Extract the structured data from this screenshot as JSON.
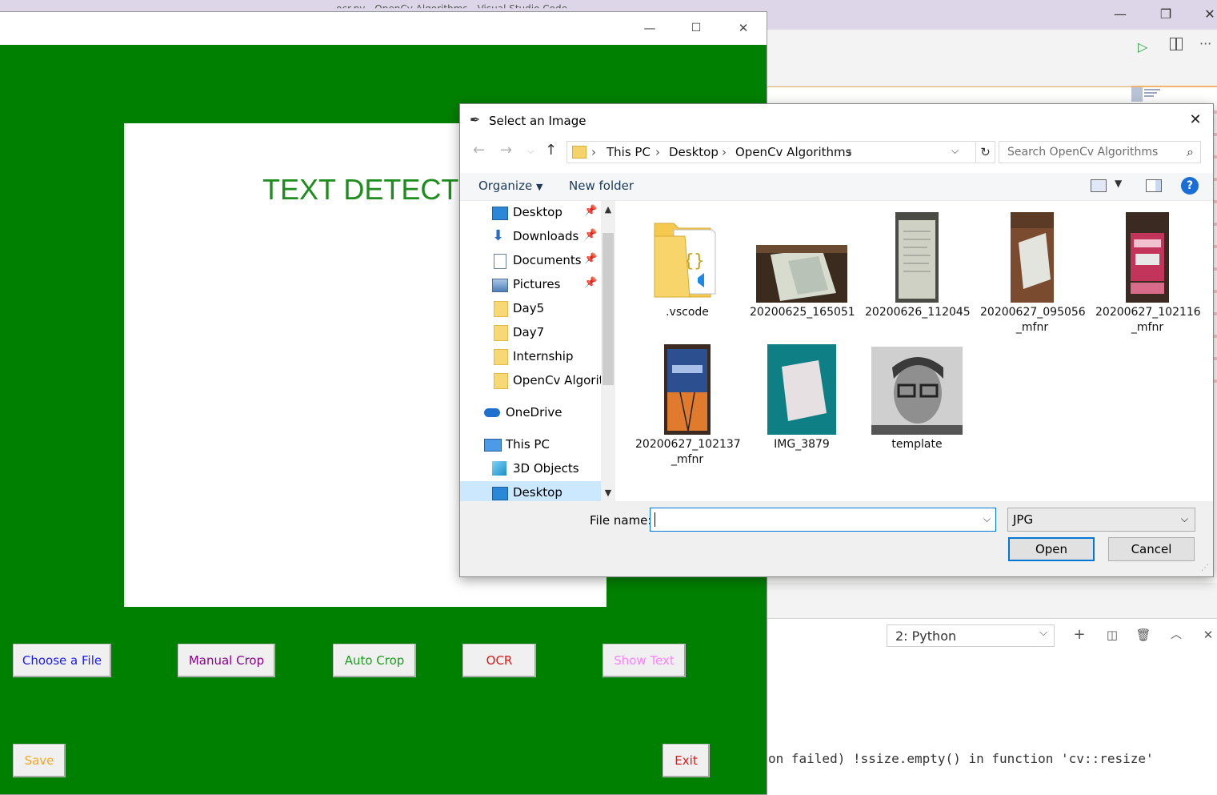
{
  "vscode": {
    "title": "ocr.py - OpenCv Algorithms - Visual Studio Code",
    "terminal_select": "2: Python",
    "terminal_output": "on failed) !ssize.empty() in function 'cv::resize'"
  },
  "app": {
    "heading": "TEXT DETECTOR",
    "buttons": {
      "choose": "Choose a File",
      "manual_crop": "Manual Crop",
      "auto_crop": "Auto Crop",
      "ocr": "OCR",
      "show_text": "Show Text",
      "save": "Save",
      "exit": "Exit"
    },
    "colors": {
      "background": "#008000",
      "choose": "#1a1aff",
      "manual_crop": "#8b008b",
      "auto_crop": "#1e9b1e",
      "ocr": "#e01818",
      "show_text": "#ff80ff",
      "save": "#f5a623",
      "exit": "#e01818"
    }
  },
  "dialog": {
    "title": "Select an Image",
    "breadcrumb": [
      "This PC",
      "Desktop",
      "OpenCv Algorithms"
    ],
    "search_placeholder": "Search OpenCv Algorithms",
    "organize": "Organize",
    "new_folder": "New folder",
    "nav_items": [
      {
        "label": "Desktop",
        "icon": "desktop-icon",
        "pinned": true
      },
      {
        "label": "Downloads",
        "icon": "download-icon",
        "pinned": true
      },
      {
        "label": "Documents",
        "icon": "documents-icon",
        "pinned": true
      },
      {
        "label": "Pictures",
        "icon": "pictures-icon",
        "pinned": true
      },
      {
        "label": "Day5",
        "icon": "folder-icon",
        "pinned": false
      },
      {
        "label": "Day7",
        "icon": "folder-icon",
        "pinned": false
      },
      {
        "label": "Internship",
        "icon": "folder-icon",
        "pinned": false
      },
      {
        "label": "OpenCv Algorith",
        "icon": "folder-icon",
        "pinned": false
      },
      {
        "label": "OneDrive",
        "icon": "cloud-icon",
        "pinned": false
      },
      {
        "label": "This PC",
        "icon": "computer-icon",
        "pinned": false
      },
      {
        "label": "3D Objects",
        "icon": "cube-icon",
        "pinned": false
      },
      {
        "label": "Desktop",
        "icon": "desktop-icon",
        "pinned": false
      }
    ],
    "files": [
      {
        "name": ".vscode"
      },
      {
        "name": "20200625_165051"
      },
      {
        "name": "20200626_112045"
      },
      {
        "name": "20200627_095056\n_mfnr"
      },
      {
        "name": "20200627_102116\n_mfnr"
      },
      {
        "name": "20200627_102137\n_mfnr"
      },
      {
        "name": "IMG_3879"
      },
      {
        "name": "template"
      }
    ],
    "file_name_label": "File name:",
    "file_name_value": "",
    "file_type": "JPG",
    "open": "Open",
    "cancel": "Cancel"
  }
}
